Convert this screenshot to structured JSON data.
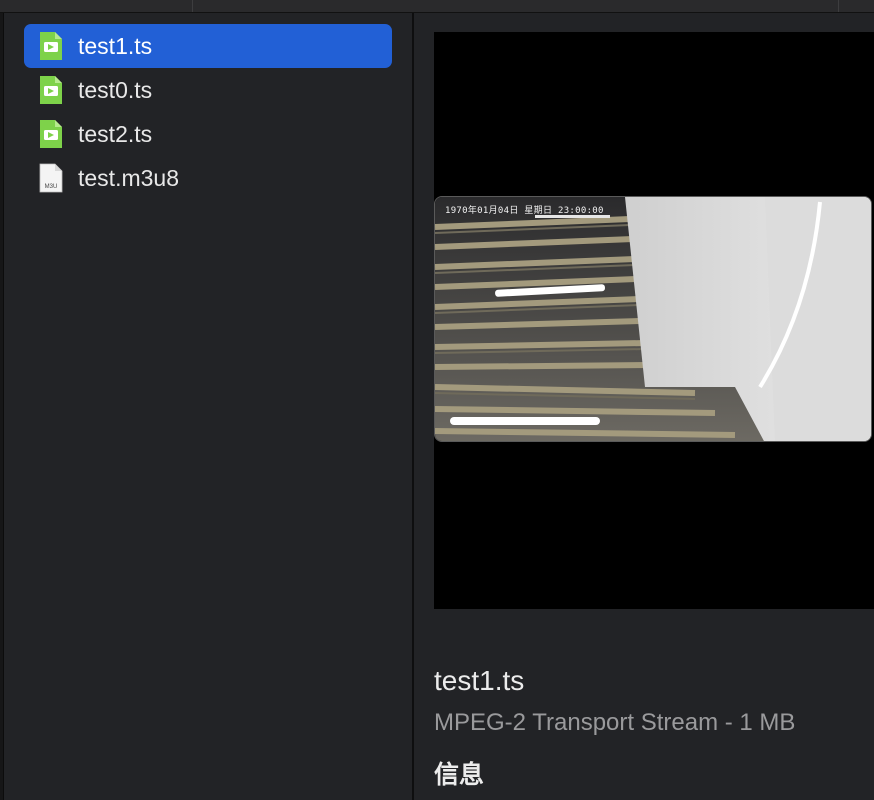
{
  "files": [
    {
      "name": "test1.ts",
      "icon": "video-file-icon",
      "selected": true
    },
    {
      "name": "test0.ts",
      "icon": "video-file-icon",
      "selected": false
    },
    {
      "name": "test2.ts",
      "icon": "video-file-icon",
      "selected": false
    },
    {
      "name": "test.m3u8",
      "icon": "m3u-file-icon",
      "selected": false,
      "icon_label": "M3U"
    }
  ],
  "preview": {
    "osd_text": "1970年01月04日 星期日 23:00:00",
    "title": "test1.ts",
    "subtitle": "MPEG-2 Transport Stream - 1 MB",
    "section_label": "信息"
  },
  "colors": {
    "selection": "#2260d6",
    "video_icon": "#7ed24a",
    "background": "#222326"
  }
}
